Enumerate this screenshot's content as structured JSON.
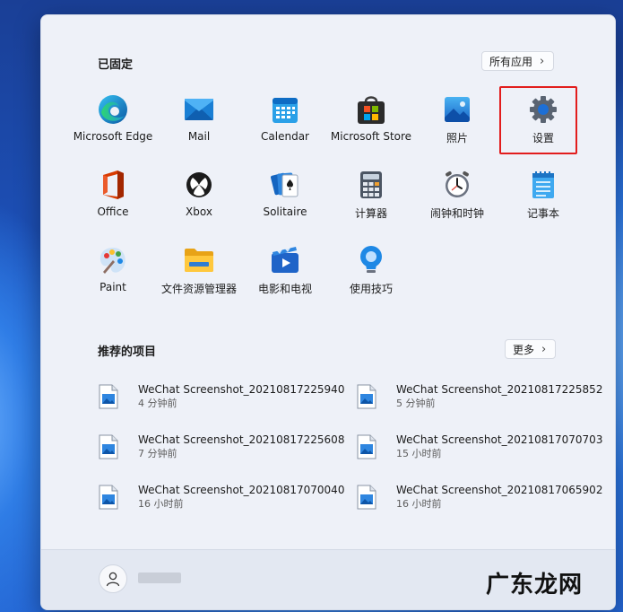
{
  "pinned": {
    "title": "已固定",
    "all_apps_label": "所有应用",
    "apps": [
      {
        "label": "Microsoft Edge",
        "icon": "edge-icon"
      },
      {
        "label": "Mail",
        "icon": "mail-icon"
      },
      {
        "label": "Calendar",
        "icon": "calendar-icon"
      },
      {
        "label": "Microsoft Store",
        "icon": "store-icon"
      },
      {
        "label": "照片",
        "icon": "photos-icon"
      },
      {
        "label": "设置",
        "icon": "gear-icon"
      },
      {
        "label": "Office",
        "icon": "office-icon"
      },
      {
        "label": "Xbox",
        "icon": "xbox-icon"
      },
      {
        "label": "Solitaire",
        "icon": "solitaire-icon"
      },
      {
        "label": "计算器",
        "icon": "calculator-icon"
      },
      {
        "label": "闹钟和时钟",
        "icon": "clock-icon"
      },
      {
        "label": "记事本",
        "icon": "notepad-icon"
      },
      {
        "label": "Paint",
        "icon": "paint-icon"
      },
      {
        "label": "文件资源管理器",
        "icon": "folder-icon"
      },
      {
        "label": "电影和电视",
        "icon": "movies-icon"
      },
      {
        "label": "使用技巧",
        "icon": "tips-icon"
      }
    ]
  },
  "recommended": {
    "title": "推荐的项目",
    "more_label": "更多",
    "items": [
      {
        "name": "WeChat Screenshot_20210817225940",
        "time": "4 分钟前"
      },
      {
        "name": "WeChat Screenshot_20210817225852",
        "time": "5 分钟前"
      },
      {
        "name": "WeChat Screenshot_20210817225608",
        "time": "7 分钟前"
      },
      {
        "name": "WeChat Screenshot_20210817070703",
        "time": "15 小时前"
      },
      {
        "name": "WeChat Screenshot_20210817070040",
        "time": "16 小时前"
      },
      {
        "name": "WeChat Screenshot_20210817065902",
        "time": "16 小时前"
      }
    ]
  },
  "watermark": "广东龙网",
  "colors": {
    "highlight": "#e21d1d",
    "accent": "#0a64d8"
  }
}
